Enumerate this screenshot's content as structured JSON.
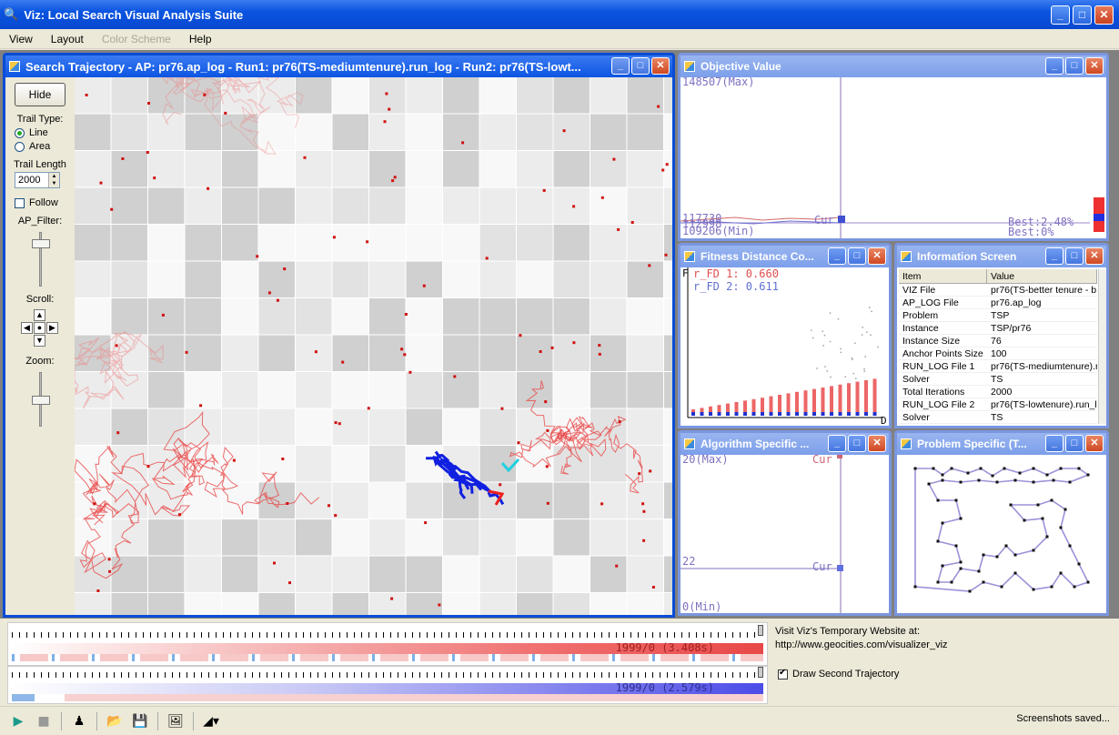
{
  "app": {
    "title": "Viz: Local Search Visual Analysis Suite",
    "win_min": "_",
    "win_max": "□",
    "win_close": "✕"
  },
  "menu": [
    "View",
    "Layout",
    "Color Scheme",
    "Help"
  ],
  "child_buttons": {
    "min": "_",
    "max": "□",
    "close": "✕"
  },
  "trajectory": {
    "title": "Search Trajectory - AP: pr76.ap_log - Run1: pr76(TS-mediumtenure).run_log - Run2: pr76(TS-lowt...",
    "hide_label": "Hide",
    "trail_type_label": "Trail Type:",
    "trail_type_options": [
      "Line",
      "Area"
    ],
    "trail_type_selected": "Line",
    "trail_length_label": "Trail Length",
    "trail_length_value": "2000",
    "follow_label": "Follow",
    "ap_filter_label": "AP_Filter:",
    "scroll_label": "Scroll:",
    "zoom_label": "Zoom:"
  },
  "objective": {
    "title": "Objective Value",
    "max_label": "148507(Max)",
    "min_label": "109206(Min)",
    "left_values": [
      "117730",
      "112998"
    ],
    "cur_label": "Cur",
    "best1": "Best:2.48%",
    "best2": "Best:0%"
  },
  "fdc": {
    "title": "Fitness Distance Co...",
    "axis_f": "F",
    "axis_d": "D",
    "r1": "r_FD 1: 0.660",
    "r2": "r_FD 2: 0.611"
  },
  "info": {
    "title": "Information Screen",
    "header": [
      "Item",
      "Value"
    ],
    "rows": [
      [
        "VIZ File",
        "pr76(TS-better tenure - b"
      ],
      [
        "AP_LOG File",
        "pr76.ap_log"
      ],
      [
        "Problem",
        "TSP"
      ],
      [
        "Instance",
        "TSP/pr76"
      ],
      [
        "Instance Size",
        "76"
      ],
      [
        "Anchor Points Size",
        "100"
      ],
      [
        "RUN_LOG File 1",
        "pr76(TS-mediumtenure).r"
      ],
      [
        "Solver",
        "TS"
      ],
      [
        "Total Iterations",
        "2000"
      ],
      [
        "RUN_LOG File 2",
        "pr76(TS-lowtenure).run_l"
      ],
      [
        "Solver",
        "TS"
      ]
    ]
  },
  "algo": {
    "title": "Algorithm Specific ...",
    "max_label": "20(Max)",
    "mid_label": "22",
    "min_label": "0(Min)",
    "cur_label": "Cur"
  },
  "problem": {
    "title": "Problem Specific (T..."
  },
  "timeline1": {
    "text": "1999/0 (3.408s)"
  },
  "timeline2": {
    "text": "1999/0 (2.579s)"
  },
  "website": {
    "line1": "Visit Viz's Temporary Website at:",
    "line2": "http://www.geocities.com/visualizer_viz"
  },
  "draw_second_label": "Draw Second Trajectory",
  "status": "Screenshots saved...",
  "colors": {
    "run1": "#ee2020",
    "run2": "#1020e0",
    "accent": "#0a4cd6"
  }
}
